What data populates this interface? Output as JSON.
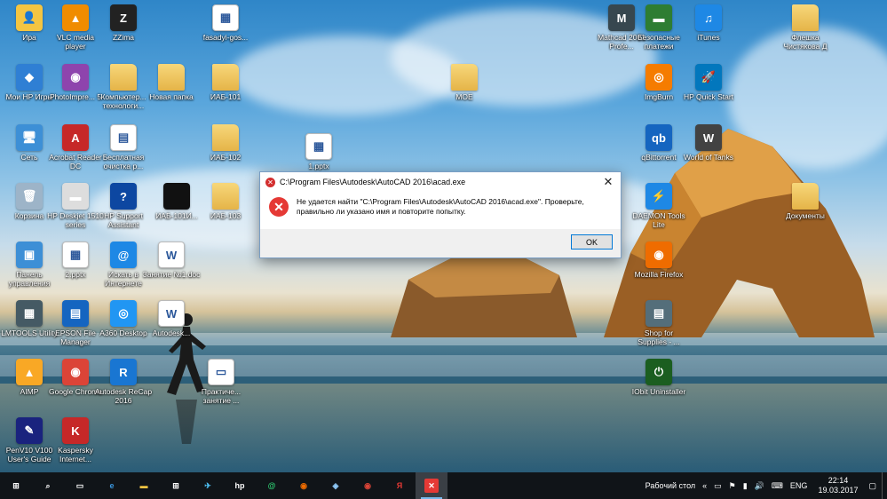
{
  "desktop_icons": [
    {
      "label": "Ира",
      "color": "#f4c542",
      "glyph": "👤",
      "kind": "user"
    },
    {
      "label": "VLC media player",
      "color": "#f08c00",
      "glyph": "▲",
      "kind": "app"
    },
    {
      "label": "ZZima",
      "color": "#222222",
      "glyph": "Z",
      "kind": "app"
    },
    {
      "label": "fasadyi-gos...",
      "color": "#ffffff",
      "glyph": "▦",
      "kind": "doc"
    },
    {
      "label": "Мои HP Игры",
      "color": "#2f7fd4",
      "glyph": "◆",
      "kind": "app"
    },
    {
      "label": "PhotoImpre... 5",
      "color": "#8e44ad",
      "glyph": "◉",
      "kind": "app"
    },
    {
      "label": "Компьютер... технологи...",
      "color": "#e8c36a",
      "glyph": "",
      "kind": "folder"
    },
    {
      "label": "Новая папка",
      "color": "#e8c36a",
      "glyph": "",
      "kind": "folder"
    },
    {
      "label": "ИАБ-101",
      "color": "#e8c36a",
      "glyph": "",
      "kind": "folder"
    },
    {
      "label": "МОЕ",
      "color": "#e8c36a",
      "glyph": "",
      "kind": "folder"
    },
    {
      "label": "Сеть",
      "color": "#3d8fd6",
      "glyph": "🖥",
      "kind": "app"
    },
    {
      "label": "Acrobat Reader DC",
      "color": "#c62828",
      "glyph": "A",
      "kind": "app"
    },
    {
      "label": "Бесплатная очистка р...",
      "color": "#ffffff",
      "glyph": "▤",
      "kind": "doc"
    },
    {
      "label": "ИАБ-102",
      "color": "#e8c36a",
      "glyph": "",
      "kind": "folder"
    },
    {
      "label": "1.pptx",
      "color": "#ffffff",
      "glyph": "▦",
      "kind": "doc"
    },
    {
      "label": "Корзина",
      "color": "#9db4c8",
      "glyph": "🗑",
      "kind": "app"
    },
    {
      "label": "HP Deskjet 1510 series",
      "color": "#dddddd",
      "glyph": "▬",
      "kind": "app"
    },
    {
      "label": "HP Support Assistant",
      "color": "#0d47a1",
      "glyph": "?",
      "kind": "app"
    },
    {
      "label": "ИАБ-101И...",
      "color": "#111111",
      "glyph": "",
      "kind": "dark"
    },
    {
      "label": "ИАБ-103",
      "color": "#e8c36a",
      "glyph": "",
      "kind": "folder"
    },
    {
      "label": "Панель управления",
      "color": "#3d8fd6",
      "glyph": "▣",
      "kind": "app"
    },
    {
      "label": "2.pptx",
      "color": "#ffffff",
      "glyph": "▦",
      "kind": "doc"
    },
    {
      "label": "Искать в Интернете",
      "color": "#1e88e5",
      "glyph": "@",
      "kind": "app"
    },
    {
      "label": "Занятие №1.doc",
      "color": "#ffffff",
      "glyph": "W",
      "kind": "doc"
    },
    {
      "label": "LMTOOLS Utility",
      "color": "#455a64",
      "glyph": "▦",
      "kind": "app"
    },
    {
      "label": "EPSON File Manager",
      "color": "#1565c0",
      "glyph": "▤",
      "kind": "app"
    },
    {
      "label": "A360 Desktop",
      "color": "#2196f3",
      "glyph": "◎",
      "kind": "app"
    },
    {
      "label": "Autodesk...",
      "color": "#ffffff",
      "glyph": "W",
      "kind": "doc"
    },
    {
      "label": "AIMP",
      "color": "#f9a825",
      "glyph": "▲",
      "kind": "app"
    },
    {
      "label": "Google Chrome",
      "color": "#db4437",
      "glyph": "◉",
      "kind": "app"
    },
    {
      "label": "Autodesk ReCap 2016",
      "color": "#1976d2",
      "glyph": "R",
      "kind": "app"
    },
    {
      "label": "Практиче... занятие ...",
      "color": "#ffffff",
      "glyph": "▭",
      "kind": "doc"
    },
    {
      "label": "PenV10 V100 User's Guide",
      "color": "#1a237e",
      "glyph": "✎",
      "kind": "app"
    },
    {
      "label": "Kaspersky Internet...",
      "color": "#c62828",
      "glyph": "K",
      "kind": "app"
    },
    {
      "label": "Mathcad 2001 Profe...",
      "color": "#37474f",
      "glyph": "M",
      "kind": "app"
    },
    {
      "label": "Безопасные платежи",
      "color": "#2e7d32",
      "glyph": "▬",
      "kind": "app"
    },
    {
      "label": "iTunes",
      "color": "#1e88e5",
      "glyph": "♫",
      "kind": "app"
    },
    {
      "label": "Флешка Чистякова Д",
      "color": "#e8c36a",
      "glyph": "",
      "kind": "folder"
    },
    {
      "label": "ImgBurn",
      "color": "#f57c00",
      "glyph": "◎",
      "kind": "app"
    },
    {
      "label": "HP Quick Start",
      "color": "#0277bd",
      "glyph": "🚀",
      "kind": "app"
    },
    {
      "label": "qBittorrent",
      "color": "#1565c0",
      "glyph": "qb",
      "kind": "app"
    },
    {
      "label": "World of Tanks",
      "color": "#424242",
      "glyph": "W",
      "kind": "app"
    },
    {
      "label": "DAEMON Tools Lite",
      "color": "#1e88e5",
      "glyph": "⚡",
      "kind": "app"
    },
    {
      "label": "Документы",
      "color": "#e8c36a",
      "glyph": "",
      "kind": "folder"
    },
    {
      "label": "Mozilla Firefox",
      "color": "#ef6c00",
      "glyph": "◉",
      "kind": "app"
    },
    {
      "label": "Shop for Supplies - ...",
      "color": "#546e7a",
      "glyph": "▤",
      "kind": "app"
    },
    {
      "label": "IObit Uninstaller",
      "color": "#1b5e20",
      "glyph": "⏻",
      "kind": "app"
    }
  ],
  "dialog": {
    "title": "C:\\Program Files\\Autodesk\\AutoCAD 2016\\acad.exe",
    "message": "Не удается найти \"C:\\Program Files\\Autodesk\\AutoCAD 2016\\acad.exe\". Проверьте, правильно ли указано имя и повторите попытку.",
    "ok_label": "OK",
    "close_glyph": "✕",
    "error_glyph": "✕"
  },
  "taskbar": {
    "buttons": [
      {
        "name": "start-button",
        "glyph": "⊞",
        "color": "#ffffff",
        "bg": "transparent",
        "state": ""
      },
      {
        "name": "search-button",
        "glyph": "⌕",
        "color": "#ffffff",
        "bg": "transparent",
        "state": ""
      },
      {
        "name": "task-view-button",
        "glyph": "▭",
        "color": "#ffffff",
        "bg": "transparent",
        "state": ""
      },
      {
        "name": "edge-button",
        "glyph": "e",
        "color": "#3a96dd",
        "bg": "transparent",
        "state": ""
      },
      {
        "name": "file-explorer-button",
        "glyph": "▬",
        "color": "#f4c542",
        "bg": "transparent",
        "state": ""
      },
      {
        "name": "store-button",
        "glyph": "⊞",
        "color": "#ffffff",
        "bg": "transparent",
        "state": ""
      },
      {
        "name": "pinned-app-button",
        "glyph": "✈",
        "color": "#4fc3f7",
        "bg": "transparent",
        "state": ""
      },
      {
        "name": "hp-button",
        "glyph": "hp",
        "color": "#ffffff",
        "bg": "transparent",
        "state": ""
      },
      {
        "name": "mail-ru-button",
        "glyph": "@",
        "color": "#2ecc71",
        "bg": "transparent",
        "state": ""
      },
      {
        "name": "firefox-button",
        "glyph": "◉",
        "color": "#ef6c00",
        "bg": "transparent",
        "state": ""
      },
      {
        "name": "shield-app-button",
        "glyph": "◈",
        "color": "#90caf9",
        "bg": "transparent",
        "state": ""
      },
      {
        "name": "chrome-button",
        "glyph": "◉",
        "color": "#db4437",
        "bg": "transparent",
        "state": ""
      },
      {
        "name": "yandex-button",
        "glyph": "Я",
        "color": "#e53935",
        "bg": "transparent",
        "state": ""
      },
      {
        "name": "error-window-button",
        "glyph": "✕",
        "color": "#ffffff",
        "bg": "#e53935",
        "state": "active"
      }
    ],
    "tray": {
      "desktop_label": "Рабочий стол",
      "chevron": "«",
      "tray_icons": [
        "▭",
        "⚑",
        "▮",
        "🔊",
        "⌨"
      ],
      "language": "ENG",
      "time": "22:14",
      "date": "19.03.2017",
      "notification_glyph": "▢"
    }
  }
}
